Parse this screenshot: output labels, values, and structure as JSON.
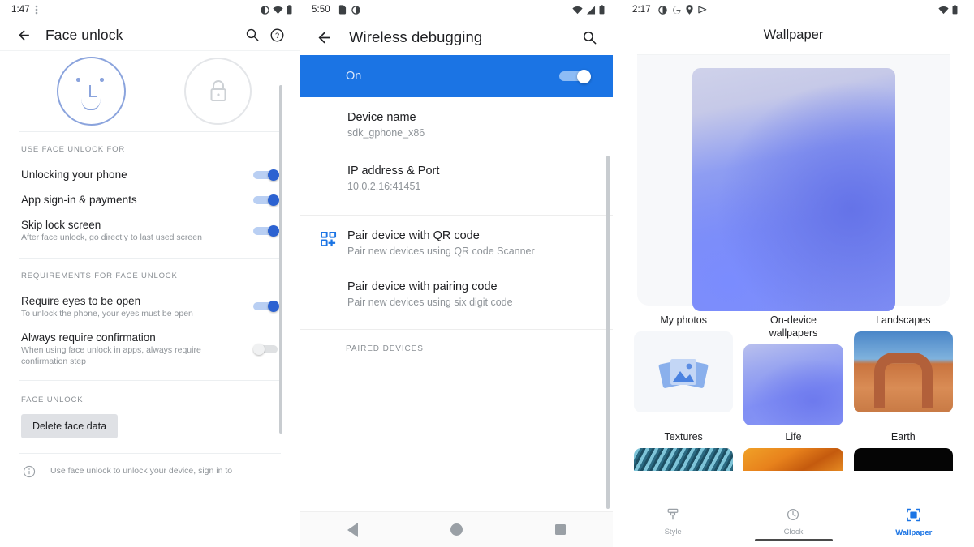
{
  "panel_face_unlock": {
    "status_bar": {
      "time": "1:47",
      "left_icons": [
        "more-vert-icon"
      ],
      "right_icons": [
        "do-not-disturb-icon",
        "wifi-icon",
        "battery-icon"
      ]
    },
    "app_bar": {
      "back_label": "back-arrow",
      "title": "Face unlock",
      "actions": [
        "search-icon",
        "help-icon"
      ]
    },
    "hero": {
      "face_icon": "face-outline-icon",
      "lock_icon": "lock-icon"
    },
    "sections": [
      {
        "label": "Use face unlock for",
        "rows": [
          {
            "title": "Unlocking your phone",
            "sub": "",
            "switch": "on"
          },
          {
            "title": "App sign-in & payments",
            "sub": "",
            "switch": "on"
          },
          {
            "title": "Skip lock screen",
            "sub": "After face unlock, go directly to last used screen",
            "switch": "on"
          }
        ]
      },
      {
        "label": "Requirements for face unlock",
        "rows": [
          {
            "title": "Require eyes to be open",
            "sub": "To unlock the phone, your eyes must be open",
            "switch": "on"
          },
          {
            "title": "Always require confirmation",
            "sub": "When using face unlock in apps, always require confirmation step",
            "switch": "off"
          }
        ]
      },
      {
        "label": "Face unlock",
        "button": "Delete face data"
      }
    ],
    "footer_note": {
      "icon": "info-icon",
      "text": "Use face unlock to unlock your device, sign in to"
    }
  },
  "panel_wireless_debugging": {
    "status_bar": {
      "time": "5:50",
      "left_icons": [
        "sim-card-icon",
        "contrast-icon"
      ],
      "right_icons": [
        "wifi-icon",
        "signal-icon",
        "battery-icon"
      ]
    },
    "app_bar": {
      "back_label": "back-arrow",
      "title": "Wireless debugging",
      "actions": [
        "search-icon"
      ]
    },
    "master_switch": {
      "label": "On",
      "state": "on",
      "accent": "#1b74e4"
    },
    "rows": [
      {
        "title": "Device name",
        "sub": "sdk_gphone_x86",
        "icon": ""
      },
      {
        "title": "IP address & Port",
        "sub": "10.0.2.16:41451",
        "icon": ""
      },
      {
        "title": "Pair device with QR code",
        "sub": "Pair new devices using QR code Scanner",
        "icon": "qr-code-icon"
      },
      {
        "title": "Pair device with pairing code",
        "sub": "Pair new devices using six digit code",
        "icon": ""
      }
    ],
    "paired_label": "Paired devices",
    "nav_bar": {
      "back": "nav-back-icon",
      "home": "nav-home-icon",
      "recents": "nav-recents-icon"
    }
  },
  "panel_wallpaper": {
    "status_bar": {
      "time": "2:17",
      "left_icons": [
        "contrast-icon",
        "google-icon",
        "location-icon",
        "play-icon"
      ],
      "right_icons": [
        "wifi-icon",
        "battery-icon"
      ]
    },
    "title": "Wallpaper",
    "preview_label": "current-wallpaper-preview",
    "categories_row1": [
      {
        "name": "My photos",
        "thumb": "my-photos-icon"
      },
      {
        "name": "On-device\nwallpapers",
        "thumb": "on-device-gradient"
      },
      {
        "name": "Landscapes",
        "thumb": "delicate-arch-photo"
      }
    ],
    "categories_row2": [
      {
        "name": "Textures",
        "thumb": "textures-photo"
      },
      {
        "name": "Life",
        "thumb": "life-photo"
      },
      {
        "name": "Earth",
        "thumb": "earth-photo"
      }
    ],
    "tabs": [
      {
        "label": "Style",
        "icon": "brush-icon",
        "active": false
      },
      {
        "label": "Clock",
        "icon": "clock-icon",
        "active": false
      },
      {
        "label": "Wallpaper",
        "icon": "wallpaper-icon",
        "active": true
      }
    ],
    "accent": "#1b74e4"
  }
}
